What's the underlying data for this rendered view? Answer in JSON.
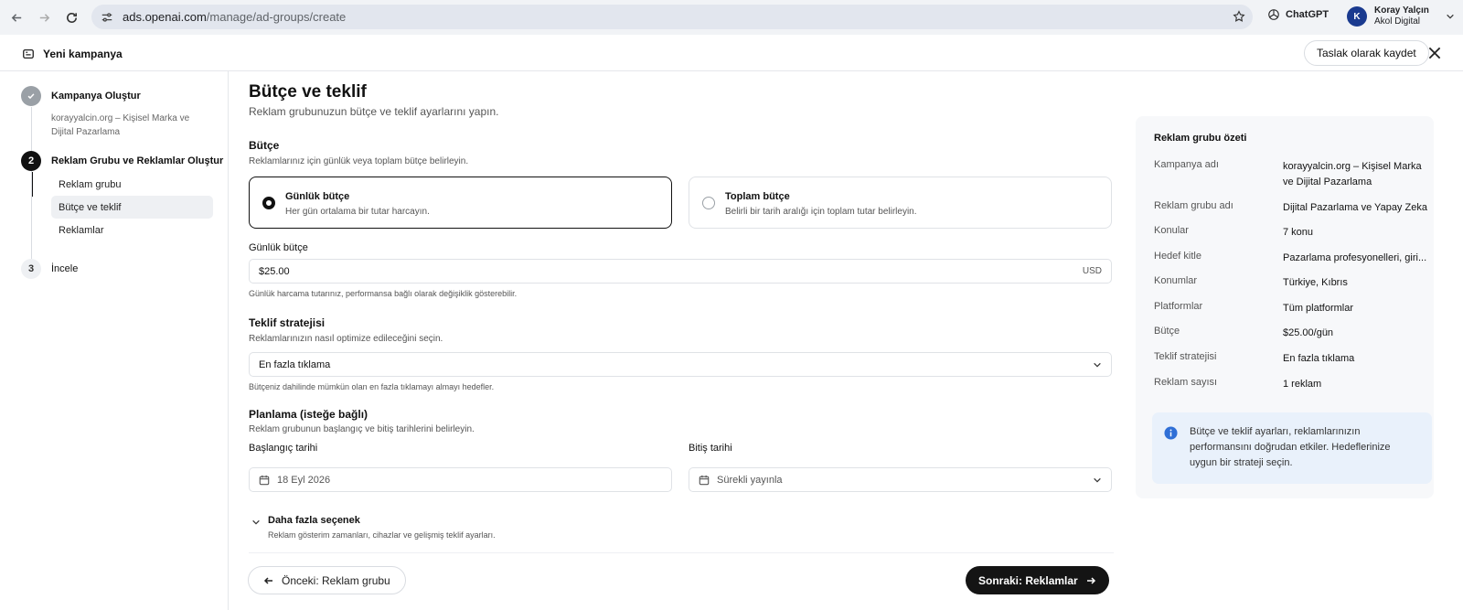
{
  "browser": {
    "url_host": "ads.openai.com",
    "url_path": "/manage/ad-groups/create",
    "chatgpt_label": "ChatGPT",
    "profile_initial": "K",
    "profile_name": "Koray Yalçın",
    "profile_org": "Akol Digital"
  },
  "header": {
    "title": "Yeni kampanya",
    "draft_button": "Taslak olarak kaydet"
  },
  "sidebar": {
    "steps": [
      {
        "number": "",
        "title": "Kampanya Oluştur",
        "subtitle": "korayyalcin.org – Kişisel Marka ve Dijital Pazarlama",
        "state": "done"
      },
      {
        "number": "2",
        "title": "Reklam Grubu ve Reklamlar Oluştur",
        "state": "current"
      },
      {
        "number": "3",
        "title": "İncele",
        "state": "upcoming"
      }
    ],
    "substeps": [
      "Reklam grubu",
      "Bütçe ve teklif",
      "Reklamlar"
    ],
    "active_substep": "Bütçe ve teklif"
  },
  "main": {
    "title": "Bütçe ve teklif",
    "subtitle": "Reklam grubunuzun bütçe ve teklif ayarlarını yapın.",
    "budget": {
      "title": "Bütçe",
      "desc": "Reklamlarınız için günlük veya toplam bütçe belirleyin.",
      "options": [
        {
          "title": "Günlük bütçe",
          "desc": "Her gün ortalama bir tutar harcayın.",
          "selected": true
        },
        {
          "title": "Toplam bütçe",
          "desc": "Belirli bir tarih aralığı için toplam tutar belirleyin.",
          "selected": false
        }
      ],
      "daily_label": "Günlük bütçe",
      "daily_value": "$25.00",
      "currency": "USD",
      "hint": "Günlük harcama tutarınız, performansa bağlı olarak değişiklik gösterebilir."
    },
    "bid": {
      "title": "Teklif stratejisi",
      "desc": "Reklamlarınızın nasıl optimize edileceğini seçin.",
      "selected": "En fazla tıklama",
      "hint": "Bütçeniz dahilinde mümkün olan en fazla tıklamayı almayı hedefler."
    },
    "schedule": {
      "title": "Planlama (isteğe bağlı)",
      "desc": "Reklam grubunun başlangıç ve bitiş tarihlerini belirleyin.",
      "start_label": "Başlangıç tarihi",
      "start_value": "18 Eyl 2026",
      "end_label": "Bitiş tarihi",
      "end_value": "Sürekli yayınla"
    },
    "more": {
      "title": "Daha fazla seçenek",
      "desc": "Reklam gösterim zamanları, cihazlar ve gelişmiş teklif ayarları."
    },
    "prev_button": "Önceki: Reklam grubu",
    "next_button": "Sonraki: Reklamlar"
  },
  "summary": {
    "title": "Reklam grubu özeti",
    "rows": [
      {
        "key": "Kampanya adı",
        "value": "korayyalcin.org – Kişisel Marka ve Dijital Pazarlama"
      },
      {
        "key": "Reklam grubu adı",
        "value": "Dijital Pazarlama ve Yapay Zeka"
      },
      {
        "key": "Konular",
        "value": "7 konu"
      },
      {
        "key": "Hedef kitle",
        "value": "Pazarlama profesyonelleri, giri..."
      },
      {
        "key": "Konumlar",
        "value": "Türkiye, Kıbrıs"
      },
      {
        "key": "Platformlar",
        "value": "Tüm platformlar"
      },
      {
        "key": "Bütçe",
        "value": "$25.00/gün"
      },
      {
        "key": "Teklif stratejisi",
        "value": "En fazla tıklama"
      },
      {
        "key": "Reklam sayısı",
        "value": "1 reklam"
      }
    ],
    "info": "Bütçe ve teklif ayarları, reklamlarınızın performansını doğrudan etkiler. Hedeflerinize uygun bir strateji seçin."
  }
}
